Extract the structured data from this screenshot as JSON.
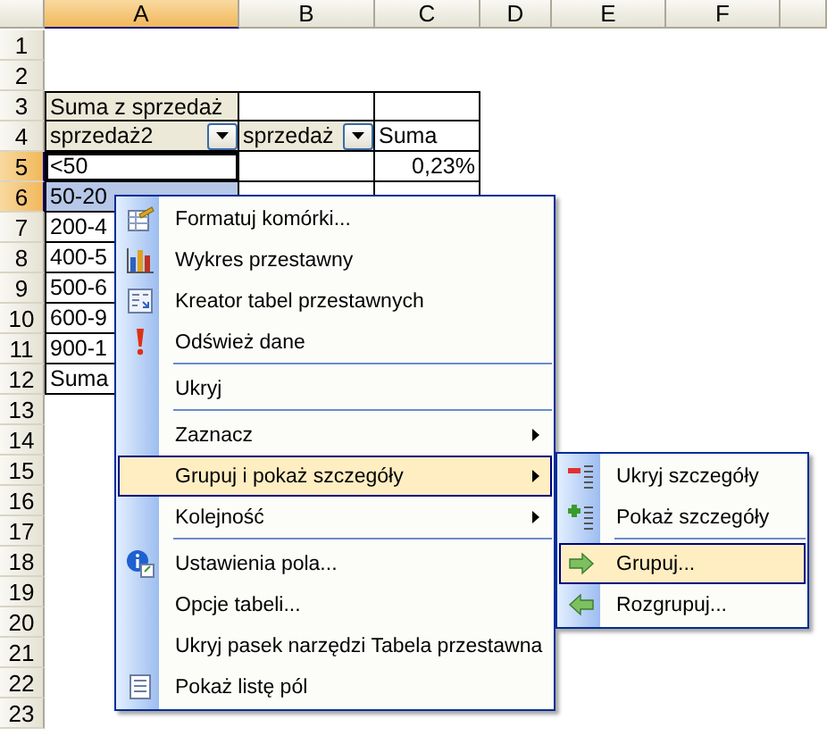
{
  "columns": [
    {
      "label": "A",
      "selected": true
    },
    {
      "label": "B",
      "selected": false
    },
    {
      "label": "C",
      "selected": false
    },
    {
      "label": "D",
      "selected": false
    },
    {
      "label": "E",
      "selected": false
    },
    {
      "label": "F",
      "selected": false
    }
  ],
  "rows": [
    {
      "header": "1",
      "selected": false,
      "in_table": false
    },
    {
      "header": "2",
      "selected": false,
      "in_table": false
    },
    {
      "header": "3",
      "selected": false,
      "in_table": true,
      "cells": {
        "a": {
          "kind": "field",
          "text": "Suma z sprzedaż"
        }
      }
    },
    {
      "header": "4",
      "selected": false,
      "in_table": true,
      "cells": {
        "a": {
          "kind": "field-dropdown",
          "text": "sprzedaż2"
        },
        "b": {
          "kind": "field-dropdown",
          "text": "sprzedaż"
        },
        "c": {
          "kind": "text",
          "text": "Suma"
        }
      }
    },
    {
      "header": "5",
      "selected": true,
      "in_table": true,
      "cells": {
        "a": {
          "kind": "text",
          "text": "<50",
          "active": true,
          "selected": false
        },
        "c": {
          "kind": "number",
          "text": "0,23%"
        }
      }
    },
    {
      "header": "6",
      "selected": true,
      "in_table": true,
      "cells": {
        "a": {
          "kind": "text",
          "text": "50-20",
          "active": false,
          "selected": true
        }
      }
    },
    {
      "header": "7",
      "selected": false,
      "in_table": true,
      "cells": {
        "a": {
          "kind": "text",
          "text": "200-4"
        }
      }
    },
    {
      "header": "8",
      "selected": false,
      "in_table": true,
      "cells": {
        "a": {
          "kind": "text",
          "text": "400-5"
        }
      }
    },
    {
      "header": "9",
      "selected": false,
      "in_table": true,
      "cells": {
        "a": {
          "kind": "text",
          "text": "500-6"
        }
      }
    },
    {
      "header": "10",
      "selected": false,
      "in_table": true,
      "cells": {
        "a": {
          "kind": "text",
          "text": "600-9"
        }
      }
    },
    {
      "header": "11",
      "selected": false,
      "in_table": true,
      "cells": {
        "a": {
          "kind": "text",
          "text": "900-1"
        }
      }
    },
    {
      "header": "12",
      "selected": false,
      "in_table": true,
      "cells": {
        "a": {
          "kind": "text",
          "text": "Suma"
        }
      }
    },
    {
      "header": "13",
      "selected": false,
      "in_table": false
    },
    {
      "header": "14",
      "selected": false,
      "in_table": false
    },
    {
      "header": "15",
      "selected": false,
      "in_table": false
    },
    {
      "header": "16",
      "selected": false,
      "in_table": false
    },
    {
      "header": "17",
      "selected": false,
      "in_table": false
    },
    {
      "header": "18",
      "selected": false,
      "in_table": false
    },
    {
      "header": "19",
      "selected": false,
      "in_table": false
    },
    {
      "header": "20",
      "selected": false,
      "in_table": false
    },
    {
      "header": "21",
      "selected": false,
      "in_table": false
    },
    {
      "header": "22",
      "selected": false,
      "in_table": false
    },
    {
      "header": "23",
      "selected": false,
      "in_table": false
    }
  ],
  "context_menu": {
    "items": [
      {
        "label": "Formatuj komórki...",
        "kind": "command",
        "highlighted": false,
        "separator_before": false
      },
      {
        "label": "Wykres przestawny",
        "kind": "command",
        "highlighted": false,
        "separator_before": false
      },
      {
        "label": "Kreator tabel przestawnych",
        "kind": "command",
        "highlighted": false,
        "separator_before": false
      },
      {
        "label": "Odśwież dane",
        "kind": "command",
        "highlighted": false,
        "separator_before": false
      },
      {
        "label": "Ukryj",
        "kind": "command",
        "highlighted": false,
        "separator_before": true
      },
      {
        "label": "Zaznacz",
        "kind": "submenu",
        "highlighted": false,
        "separator_before": true
      },
      {
        "label": "Grupuj i pokaż szczegóły",
        "kind": "submenu",
        "highlighted": true,
        "separator_before": false
      },
      {
        "label": "Kolejność",
        "kind": "submenu",
        "highlighted": false,
        "separator_before": false
      },
      {
        "label": "Ustawienia pola...",
        "kind": "command",
        "highlighted": false,
        "separator_before": true
      },
      {
        "label": "Opcje tabeli...",
        "kind": "command",
        "highlighted": false,
        "separator_before": false
      },
      {
        "label": "Ukryj pasek narzędzi Tabela przestawna",
        "kind": "command",
        "highlighted": false,
        "separator_before": false
      },
      {
        "label": "Pokaż listę pól",
        "kind": "command",
        "highlighted": false,
        "separator_before": false
      }
    ]
  },
  "submenu": {
    "items": [
      {
        "label": "Ukryj szczegóły",
        "highlighted": false,
        "separator_before": false
      },
      {
        "label": "Pokaż szczegóły",
        "highlighted": false,
        "separator_before": false
      },
      {
        "label": "Grupuj...",
        "highlighted": true,
        "separator_before": true
      },
      {
        "label": "Rozgrupuj...",
        "highlighted": false,
        "separator_before": false
      }
    ]
  }
}
